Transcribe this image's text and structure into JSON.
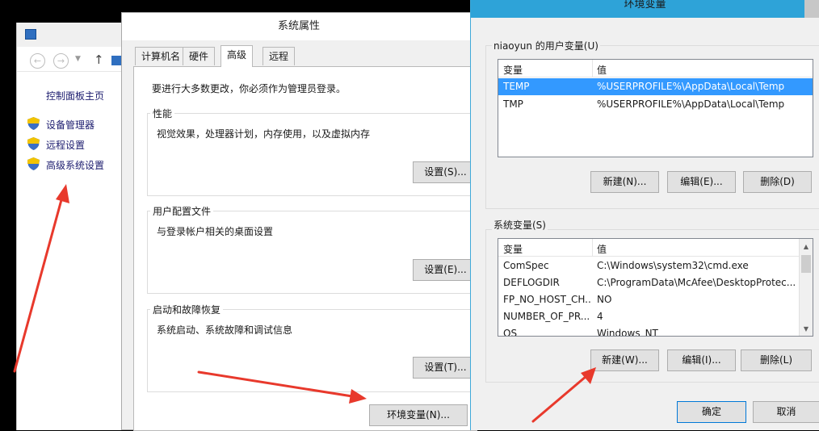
{
  "control_panel": {
    "home_link": "控制面板主页",
    "links": [
      "设备管理器",
      "远程设置",
      "高级系统设置"
    ]
  },
  "system_properties": {
    "title": "系统属性",
    "tabs": [
      "计算机名",
      "硬件",
      "高级",
      "远程"
    ],
    "admin_note": "要进行大多数更改，你必须作为管理员登录。",
    "performance": {
      "label": "性能",
      "desc": "视觉效果，处理器计划，内存使用，以及虚拟内存",
      "button": "设置(S)..."
    },
    "user_profiles": {
      "label": "用户配置文件",
      "desc": "与登录帐户相关的桌面设置",
      "button": "设置(E)..."
    },
    "startup_recovery": {
      "label": "启动和故障恢复",
      "desc": "系统启动、系统故障和调试信息",
      "button": "设置(T)..."
    },
    "env_button": "环境变量(N)..."
  },
  "environment_variables": {
    "title": "环境变量",
    "user_group": "niaoyun 的用户变量(U)",
    "system_group": "系统变量(S)",
    "col_var": "变量",
    "col_val": "值",
    "user_vars": [
      {
        "name": "TEMP",
        "value": "%USERPROFILE%\\AppData\\Local\\Temp"
      },
      {
        "name": "TMP",
        "value": "%USERPROFILE%\\AppData\\Local\\Temp"
      }
    ],
    "system_vars": [
      {
        "name": "ComSpec",
        "value": "C:\\Windows\\system32\\cmd.exe"
      },
      {
        "name": "DEFLOGDIR",
        "value": "C:\\ProgramData\\McAfee\\DesktopProtec..."
      },
      {
        "name": "FP_NO_HOST_CH...",
        "value": "NO"
      },
      {
        "name": "NUMBER_OF_PR...",
        "value": "4"
      },
      {
        "name": "OS",
        "value": "Windows_NT"
      }
    ],
    "user_buttons": {
      "new": "新建(N)...",
      "edit": "编辑(E)...",
      "delete": "删除(D)"
    },
    "system_buttons": {
      "new": "新建(W)...",
      "edit": "编辑(I)...",
      "delete": "删除(L)"
    },
    "ok": "确定",
    "cancel": "取消"
  },
  "colors": {
    "selection": "#3399ff",
    "title_accent": "#2ea3d8",
    "annotation_arrow": "#e8392c"
  }
}
